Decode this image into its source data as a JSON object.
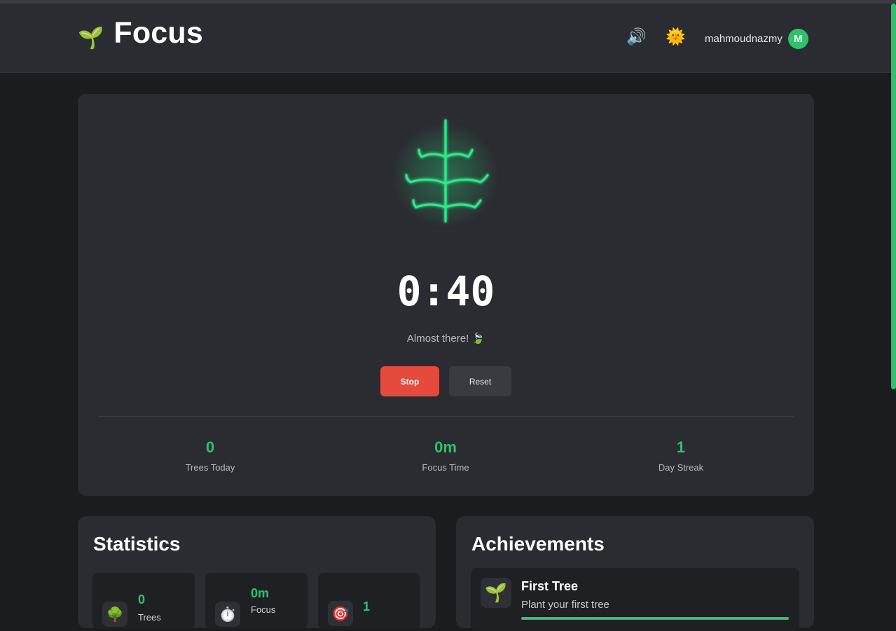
{
  "header": {
    "brand_icon": "🌱",
    "title": "Focus",
    "sound_icon": "🔊",
    "theme_icon": "🌞",
    "username": "mahmoudnazmy",
    "avatar_initial": "M"
  },
  "timer": {
    "time": "0:40",
    "message": "Almost there! 🍃",
    "stop_label": "Stop",
    "reset_label": "Reset"
  },
  "summary": [
    {
      "value": "0",
      "label": "Trees Today"
    },
    {
      "value": "0m",
      "label": "Focus Time"
    },
    {
      "value": "1",
      "label": "Day Streak"
    }
  ],
  "statistics": {
    "title": "Statistics",
    "cards": [
      {
        "icon": "🌳",
        "value": "0",
        "label": "Trees"
      },
      {
        "icon": "⏱️",
        "value": "0m",
        "label": "Focus"
      },
      {
        "icon": "🎯",
        "value": "1",
        "label": ""
      }
    ]
  },
  "achievements": {
    "title": "Achievements",
    "items": [
      {
        "icon": "🌱",
        "title": "First Tree",
        "description": "Plant your first tree",
        "progress": 1.0
      }
    ]
  },
  "colors": {
    "accent": "#2fc26a",
    "stop": "#e54a3c",
    "background": "#1b1c20",
    "card": "#2b2c31"
  }
}
